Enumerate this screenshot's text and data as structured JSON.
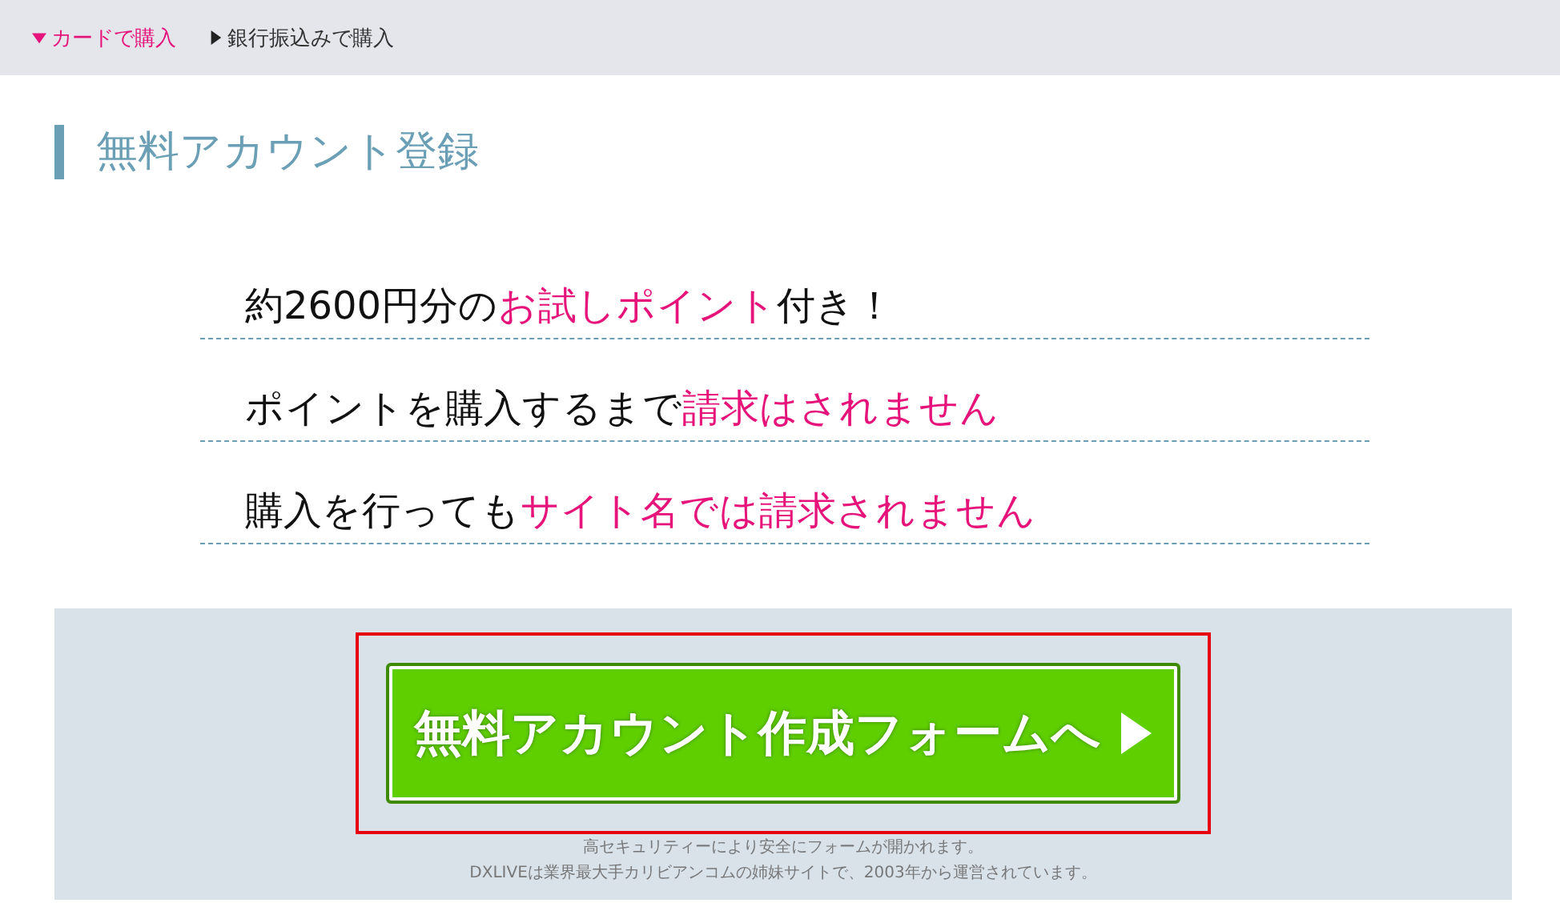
{
  "tabs": [
    {
      "label": "カードで購入",
      "selected": true
    },
    {
      "label": "銀行振込みで購入",
      "selected": false
    }
  ],
  "heading": "無料アカウント登録",
  "features": [
    [
      {
        "text": "約2600円分の",
        "highlight": false
      },
      {
        "text": "お試しポイント",
        "highlight": true
      },
      {
        "text": "付き！",
        "highlight": false
      }
    ],
    [
      {
        "text": "ポイントを購入するまで",
        "highlight": false
      },
      {
        "text": "請求はされません",
        "highlight": true
      }
    ],
    [
      {
        "text": "購入を行っても",
        "highlight": false
      },
      {
        "text": "サイト名では請求されません",
        "highlight": true
      }
    ]
  ],
  "cta_button": "無料アカウント作成フォームへ",
  "notes": [
    "高セキュリティーにより安全にフォームが開かれます。",
    "DXLIVEは業界最大手カリビアンコムの姉妹サイトで、2003年から運営されています。"
  ]
}
